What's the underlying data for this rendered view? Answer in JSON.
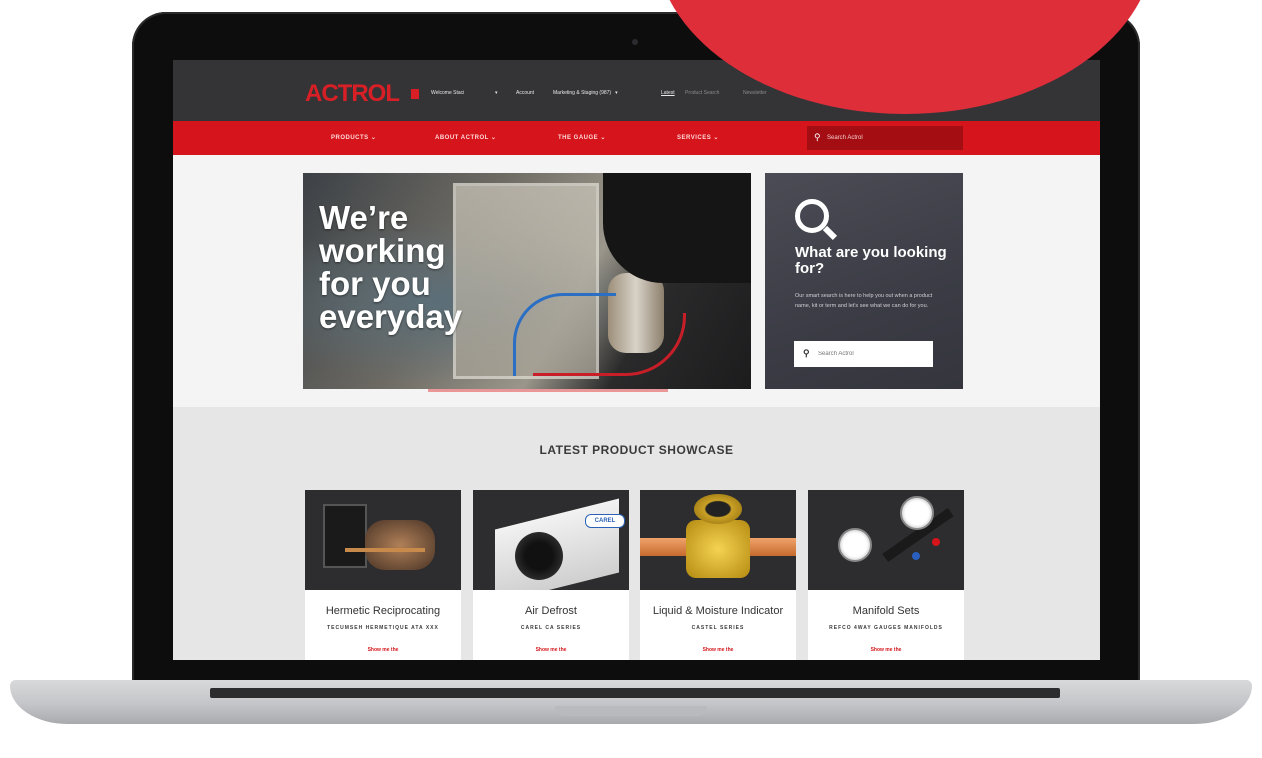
{
  "site": {
    "logo": "ACTROL",
    "top_nav": {
      "welcome": "Welcome Staci",
      "account": "Account",
      "marketing": "Marketing & Staging (987)",
      "link1": "Latest",
      "link2": "Product Search",
      "link3": "Newsletter"
    },
    "main_nav": [
      {
        "label": "PRODUCTS"
      },
      {
        "label": "ABOUT ACTROL"
      },
      {
        "label": "THE GAUGE"
      },
      {
        "label": "SERVICES"
      }
    ],
    "nav_search_placeholder": "Search Actrol"
  },
  "hero": {
    "title_lines": [
      "We’re",
      "working",
      "for you",
      "everyday"
    ]
  },
  "search_panel": {
    "heading": "What are you looking for?",
    "body": "Our smart search is here to help you out when a product name, kit or term and let’s see what we can do for you.",
    "input_placeholder": "Search Actrol"
  },
  "showcase": {
    "title": "LATEST PRODUCT SHOWCASE",
    "products": [
      {
        "title": "Hermetic Reciprocating",
        "subtitle": "TECUMSEH HERMETIQUE ATA XXX",
        "link": "Show me the"
      },
      {
        "title": "Air Defrost",
        "subtitle": "CAREL CA SERIES",
        "link": "Show me the"
      },
      {
        "title": "Liquid & Moisture Indicator",
        "subtitle": "CASTEL SERIES",
        "link": "Show me the"
      },
      {
        "title": "Manifold Sets",
        "subtitle": "REFCO 4WAY GAUGES MANIFOLDS",
        "link": "Show me the"
      }
    ],
    "product2_badge": "CAREL"
  },
  "colors": {
    "brand_red": "#d5141b",
    "topbar": "#343436",
    "accent_circle": "#dd2e3a"
  }
}
